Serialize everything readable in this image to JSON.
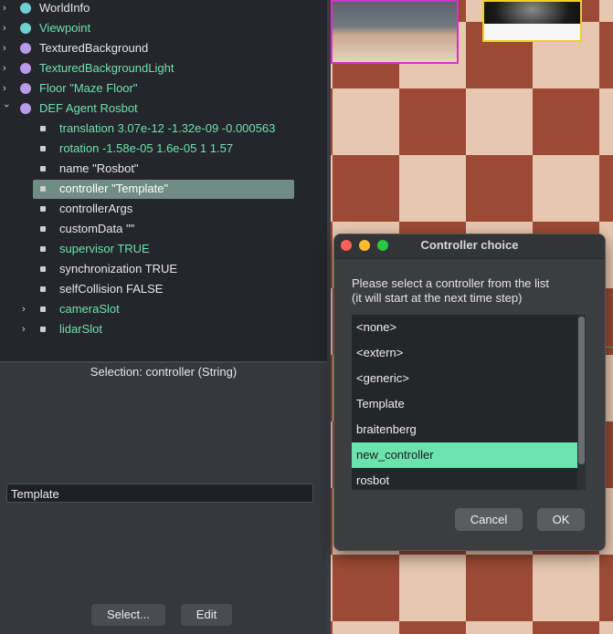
{
  "scene_tree": {
    "items": [
      {
        "label": "WorldInfo",
        "expanded": false,
        "color": "#e6e6e6",
        "dot": "#6fd0d0"
      },
      {
        "label": "Viewpoint",
        "expanded": false,
        "color": "#6be3ad",
        "dot": "#6fd0d0"
      },
      {
        "label": "TexturedBackground",
        "expanded": false,
        "color": "#e6e6e6",
        "dot": "#b79ae8"
      },
      {
        "label": "TexturedBackgroundLight",
        "expanded": false,
        "color": "#6be3ad",
        "dot": "#b79ae8"
      },
      {
        "label": "Floor \"Maze Floor\"",
        "expanded": false,
        "color": "#6be3ad",
        "dot": "#b79ae8"
      },
      {
        "label": "DEF Agent Rosbot",
        "expanded": true,
        "color": "#6be3ad",
        "dot": "#b79ae8"
      }
    ],
    "fields": [
      {
        "label": "translation 3.07e-12 -1.32e-09 -0.000563",
        "color": "#6be3ad"
      },
      {
        "label": "rotation -1.58e-05 1.6e-05 1 1.57",
        "color": "#6be3ad"
      },
      {
        "label": "name \"Rosbot\"",
        "color": "#e6e6e6"
      },
      {
        "label": "controller \"Template\"",
        "color": "#ffffff",
        "selected": true
      },
      {
        "label": "controllerArgs",
        "color": "#e6e6e6"
      },
      {
        "label": "customData \"\"",
        "color": "#e6e6e6"
      },
      {
        "label": "supervisor TRUE",
        "color": "#6be3ad"
      },
      {
        "label": "synchronization TRUE",
        "color": "#e6e6e6"
      },
      {
        "label": "selfCollision FALSE",
        "color": "#e6e6e6"
      },
      {
        "label": "cameraSlot",
        "color": "#6be3ad",
        "expandable": true
      },
      {
        "label": "lidarSlot",
        "color": "#6be3ad",
        "expandable": true
      }
    ]
  },
  "field_editor": {
    "selection_title": "Selection: controller (String)",
    "value": "Template",
    "select_button": "Select...",
    "edit_button": "Edit"
  },
  "dialog": {
    "title": "Controller choice",
    "message_line1": "Please select a controller from the list",
    "message_line2": "(it will start at the next time step)",
    "options": [
      "<none>",
      "<extern>",
      "<generic>",
      "Template",
      "braitenberg",
      "new_controller",
      "rosbot"
    ],
    "selected_option": "new_controller",
    "cancel_button": "Cancel",
    "ok_button": "OK"
  },
  "colors": {
    "accent_green": "#6be3ad",
    "selection_row": "#6f8d84",
    "traffic_close": "#fe5f57",
    "traffic_min": "#febc2e",
    "traffic_max": "#28c840"
  }
}
